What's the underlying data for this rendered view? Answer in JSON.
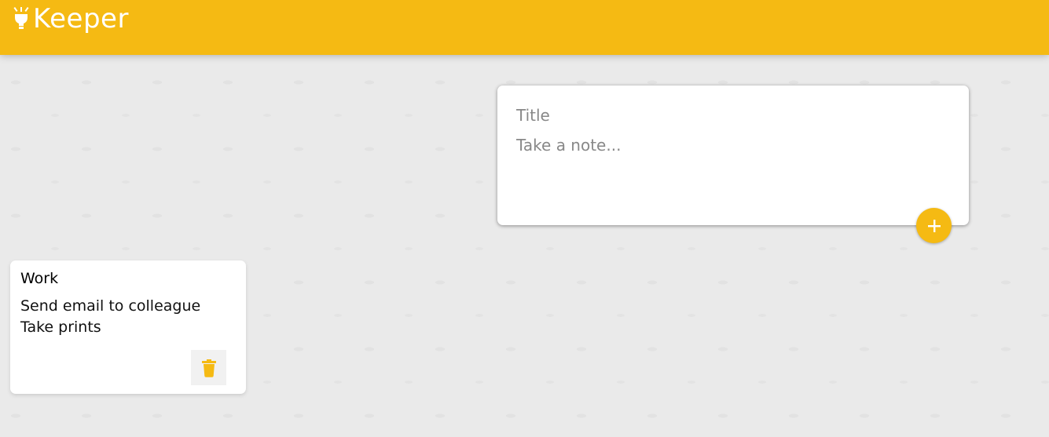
{
  "header": {
    "brand_name": "Keeper",
    "brand_icon": "lightbulb-icon",
    "color": "#f5ba13"
  },
  "create_note": {
    "title_placeholder": "Title",
    "content_placeholder": "Take a note...",
    "add_icon": "plus-icon"
  },
  "notes": [
    {
      "title": "Work",
      "lines": [
        "Send email to colleague",
        "Take prints"
      ],
      "delete_icon": "trash-icon"
    }
  ],
  "colors": {
    "accent": "#f5ba13",
    "background": "#eaeaea"
  }
}
